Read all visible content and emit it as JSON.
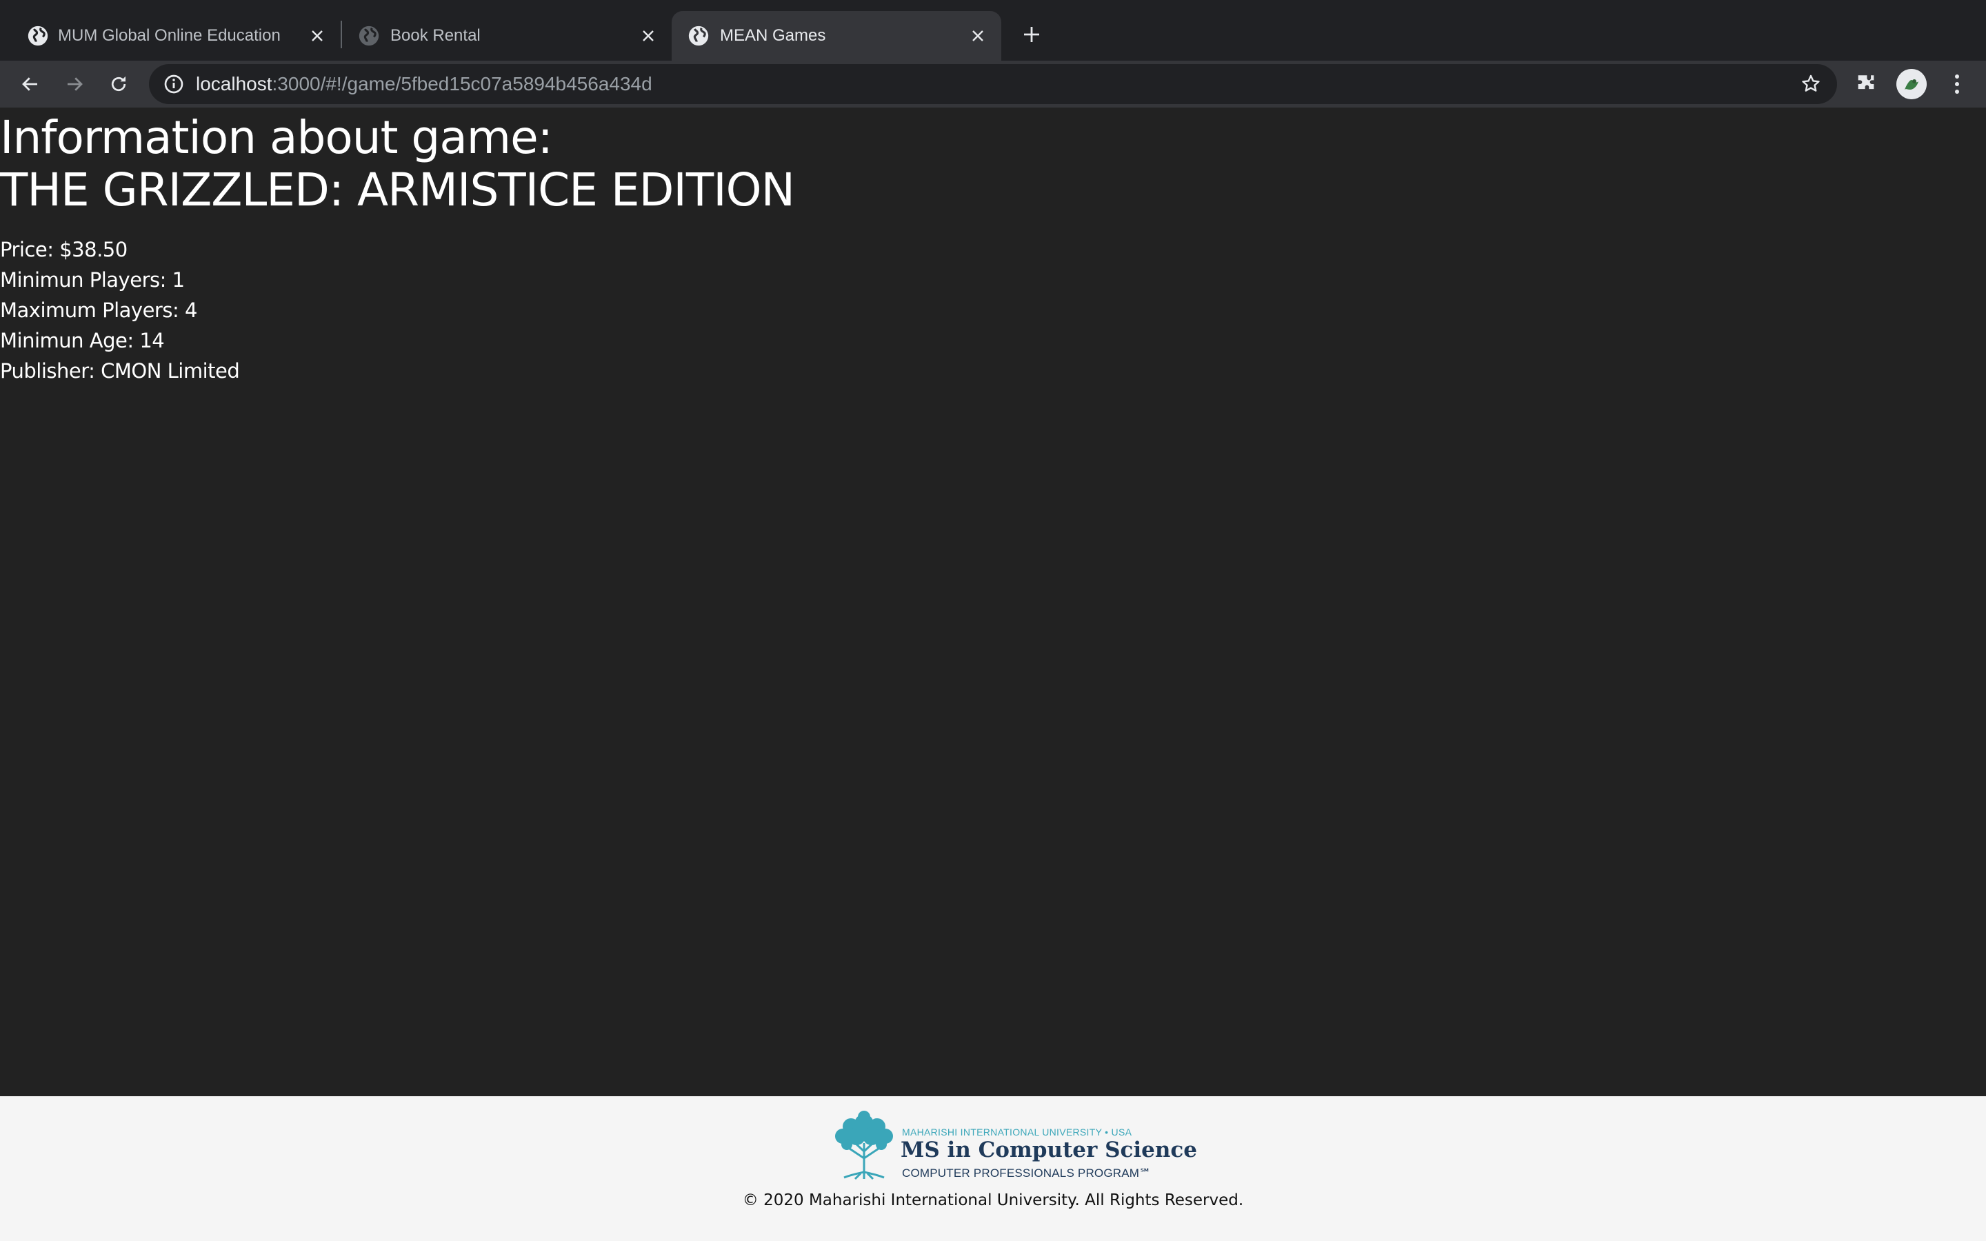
{
  "browser": {
    "tabs": [
      {
        "title": "MUM Global Online Education",
        "active": false
      },
      {
        "title": "Book Rental",
        "active": false
      },
      {
        "title": "MEAN Games",
        "active": true
      }
    ],
    "url_host": "localhost",
    "url_path": ":3000/#!/game/5fbed15c07a5894b456a434d"
  },
  "page": {
    "heading_line1": "Information about game:",
    "heading_line2": "THE GRIZZLED: ARMISTICE EDITION",
    "details": [
      "Price: $38.50",
      "Minimun Players: 1",
      "Maximum Players: 4",
      "Minimun Age: 14",
      "Publisher: CMON Limited"
    ]
  },
  "footer": {
    "logo_university": "MAHARISHI INTERNATIONAL UNIVERSITY • USA",
    "logo_program": "MS in Computer Science",
    "logo_subtitle": "COMPUTER PROFESSIONALS PROGRAM℠",
    "copyright": "© 2020 Maharishi International University. All Rights Reserved."
  },
  "colors": {
    "page_bg": "#222222",
    "tab_strip": "#202124",
    "toolbar": "#35363a",
    "footer_bg": "#f5f5f5",
    "logo_teal": "#3aa6b9",
    "logo_navy": "#1f3a5a"
  }
}
